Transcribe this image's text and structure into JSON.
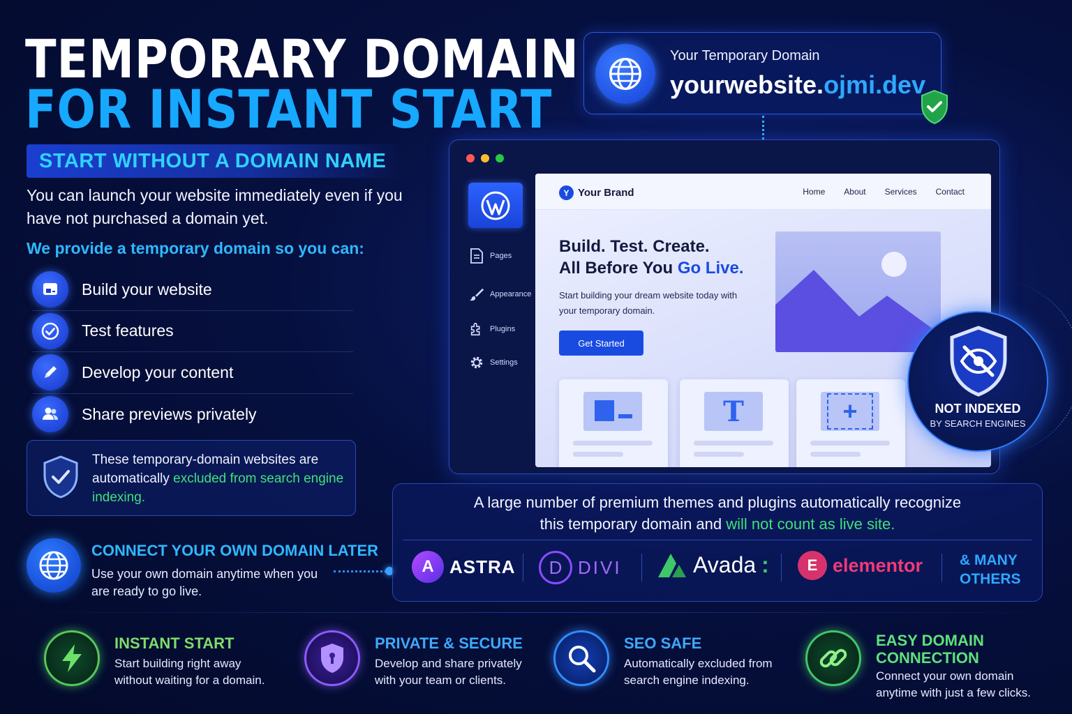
{
  "title": {
    "line1": "TEMPORARY DOMAIN",
    "line2": "FOR INSTANT START"
  },
  "ribbon": "START WITHOUT A DOMAIN NAME",
  "intro": "You can launch your website immediately even if you have not purchased a domain yet.",
  "provide": "We provide a temporary domain so you can:",
  "features": [
    {
      "icon": "layout-icon",
      "label": "Build your website"
    },
    {
      "icon": "check-circle-icon",
      "label": "Test features"
    },
    {
      "icon": "pencil-icon",
      "label": "Develop your content"
    },
    {
      "icon": "users-icon",
      "label": "Share previews privately"
    }
  ],
  "notice": {
    "text_before": "These temporary-domain websites are automatically ",
    "highlight": "excluded from search engine indexing."
  },
  "connect": {
    "title": "CONNECT YOUR OWN DOMAIN LATER",
    "text": "Use your own domain anytime when you are ready to go live."
  },
  "domain_card": {
    "label": "Your Temporary Domain",
    "domain_main": "yourwebsite.",
    "domain_accent": "ojmi.dev"
  },
  "browser": {
    "sidebar": [
      "Pages",
      "Appearance",
      "Plugins",
      "Settings"
    ],
    "brand": "Your Brand",
    "brand_initial": "Y",
    "menu": [
      "Home",
      "About",
      "Services",
      "Contact"
    ],
    "hero_line1": "Build. Test. Create.",
    "hero_line2_before": "All Before You ",
    "hero_line2_accent": "Go Live.",
    "hero_sub": "Start building your dream website today with your temporary domain.",
    "cta": "Get Started",
    "card_glyph_text": "T",
    "card_glyph_plus": "+"
  },
  "not_indexed": {
    "line1": "NOT INDEXED",
    "line2": "BY SEARCH ENGINES"
  },
  "themes": {
    "line1": "A large number of premium themes and plugins automatically recognize",
    "line2_before": "this temporary domain and ",
    "line2_highlight": "will not count as live site.",
    "logos": [
      "ASTRA",
      "DIVI",
      "Avada",
      "elementor"
    ],
    "logo_glyphs": {
      "astra": "A",
      "divi": "D",
      "elementor": "E",
      "avada_suffix": ":"
    },
    "more": "& MANY OTHERS"
  },
  "bottom": [
    {
      "icon": "bolt-icon",
      "title": "INSTANT START",
      "text": "Start building right away without waiting for a domain.",
      "color": "#7fdc6a"
    },
    {
      "icon": "lock-shield-icon",
      "title": "PRIVATE & SECURE",
      "text": "Develop and share privately with your team or clients.",
      "color": "#3fa8ff"
    },
    {
      "icon": "search-icon",
      "title": "SEO SAFE",
      "text": "Automatically excluded from search engine indexing.",
      "color": "#3fa8ff"
    },
    {
      "icon": "link-icon",
      "title": "EASY DOMAIN CONNECTION",
      "text": "Connect your own domain anytime with just a few clicks.",
      "color": "#5fe07a"
    }
  ],
  "colors": {
    "accent": "#17a8ff",
    "highlight_green": "#3fe07a",
    "brand_blue": "#1a4be0"
  }
}
